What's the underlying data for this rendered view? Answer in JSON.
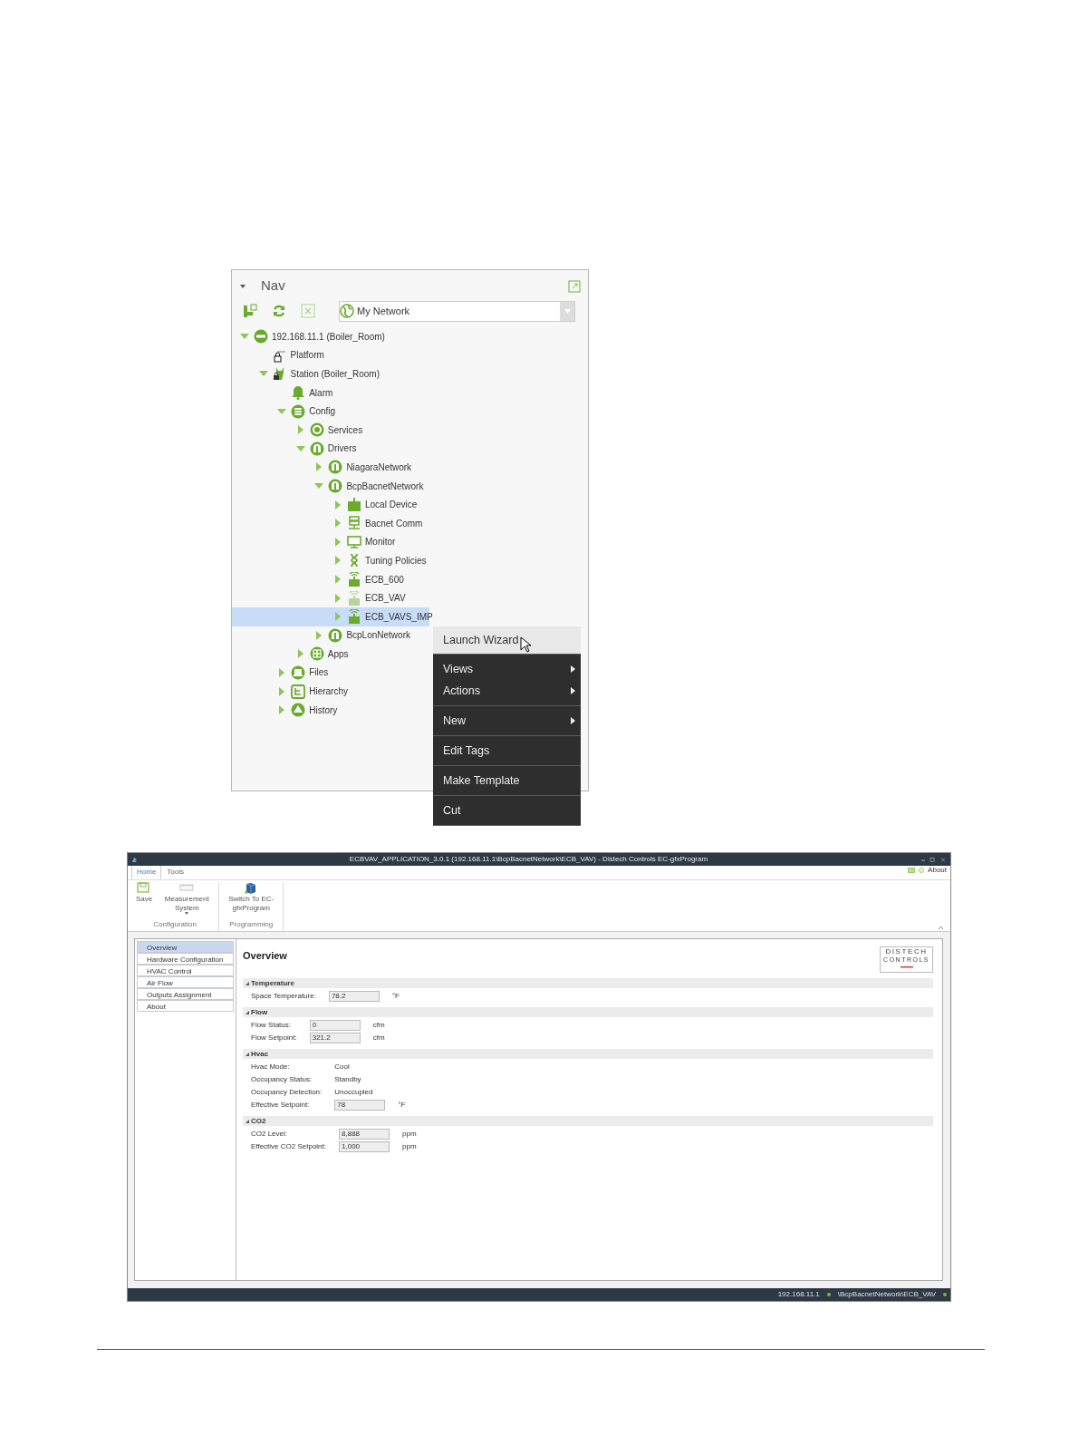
{
  "nav_panel": {
    "title": "Nav",
    "dropdown": {
      "value": "My Network"
    },
    "tree": [
      {
        "label": "192.168.11.1 (Boiler_Room)",
        "kind": "host",
        "expanded": true,
        "selected": false,
        "disabled": false,
        "children": [
          {
            "label": "Platform",
            "kind": "platform",
            "selected": false,
            "disabled": false
          },
          {
            "label": "Station (Boiler_Room)",
            "kind": "station",
            "expanded": true,
            "selected": false,
            "disabled": false,
            "children": [
              {
                "label": "Alarm",
                "kind": "alarm",
                "selected": false,
                "disabled": false
              },
              {
                "label": "Config",
                "kind": "config",
                "expanded": true,
                "selected": false,
                "disabled": false,
                "children": [
                  {
                    "label": "Services",
                    "kind": "services",
                    "expanded": false,
                    "selected": false,
                    "disabled": false
                  },
                  {
                    "label": "Drivers",
                    "kind": "network",
                    "expanded": true,
                    "selected": false,
                    "disabled": false,
                    "children": [
                      {
                        "label": "NiagaraNetwork",
                        "kind": "network",
                        "expanded": false,
                        "selected": false,
                        "disabled": false
                      },
                      {
                        "label": "BcpBacnetNetwork",
                        "kind": "network",
                        "expanded": true,
                        "selected": false,
                        "disabled": false,
                        "children": [
                          {
                            "label": "Local Device",
                            "kind": "device",
                            "expanded": false,
                            "selected": false,
                            "disabled": false
                          },
                          {
                            "label": "Bacnet Comm",
                            "kind": "comm",
                            "expanded": false,
                            "selected": false,
                            "disabled": false
                          },
                          {
                            "label": "Monitor",
                            "kind": "monitor",
                            "expanded": false,
                            "selected": false,
                            "disabled": false
                          },
                          {
                            "label": "Tuning Policies",
                            "kind": "policies",
                            "expanded": false,
                            "selected": false,
                            "disabled": false
                          },
                          {
                            "label": "ECB_600",
                            "kind": "controller",
                            "expanded": false,
                            "selected": false,
                            "disabled": false
                          },
                          {
                            "label": "ECB_VAV",
                            "kind": "controller",
                            "expanded": false,
                            "selected": false,
                            "disabled": true
                          },
                          {
                            "label": "ECB_VAVS_IMP",
                            "kind": "controller",
                            "expanded": false,
                            "selected": true,
                            "disabled": false
                          }
                        ]
                      },
                      {
                        "label": "BcpLonNetwork",
                        "kind": "network",
                        "expanded": false,
                        "selected": false,
                        "disabled": false
                      }
                    ]
                  },
                  {
                    "label": "Apps",
                    "kind": "apps",
                    "expanded": false,
                    "selected": false,
                    "disabled": false
                  }
                ]
              },
              {
                "label": "Files",
                "kind": "files",
                "expanded": false,
                "selected": false,
                "disabled": false
              },
              {
                "label": "Hierarchy",
                "kind": "hierarchy",
                "expanded": false,
                "selected": false,
                "disabled": false
              },
              {
                "label": "History",
                "kind": "history",
                "expanded": false,
                "selected": false,
                "disabled": false
              }
            ]
          }
        ]
      }
    ],
    "context_menu": {
      "groups": [
        {
          "items": [
            {
              "label": "Launch Wizard",
              "selected": true,
              "submenu": false
            }
          ]
        },
        {
          "items": [
            {
              "label": "Views",
              "selected": false,
              "submenu": true
            },
            {
              "label": "Actions",
              "selected": false,
              "submenu": true
            }
          ]
        },
        {
          "items": [
            {
              "label": "New",
              "selected": false,
              "submenu": true
            }
          ]
        },
        {
          "items": [
            {
              "label": "Edit Tags",
              "selected": false,
              "submenu": false
            }
          ]
        },
        {
          "items": [
            {
              "label": "Make Template",
              "selected": false,
              "submenu": false
            }
          ]
        },
        {
          "items": [
            {
              "label": "Cut",
              "selected": false,
              "submenu": false
            }
          ]
        }
      ]
    }
  },
  "app_window": {
    "title": "ECBVAV_APPLICATION_3.0.1 (192.168.11.1\\BcpBacnetNetwork\\ECB_VAV) - Distech Controls EC-gfxProgram",
    "ribbon_tabs": [
      {
        "label": "Home",
        "selected": true
      },
      {
        "label": "Tools",
        "selected": false
      }
    ],
    "about": "About",
    "ribbon_groups": [
      {
        "label": "Configuration",
        "buttons": [
          {
            "label": "Save",
            "kind": "save",
            "dropdown": false
          },
          {
            "label": "Measurement System",
            "kind": "measure",
            "dropdown": true
          }
        ]
      },
      {
        "label": "Programming",
        "buttons": [
          {
            "label": "Switch To EC-gfxProgram",
            "kind": "switch",
            "dropdown": false
          }
        ]
      }
    ],
    "side_nav": [
      {
        "label": "Overview",
        "selected": true
      },
      {
        "label": "Hardware Configuration",
        "selected": false
      },
      {
        "label": "HVAC Control",
        "selected": false
      },
      {
        "label": "Air Flow",
        "selected": false
      },
      {
        "label": "Outputs Assignment",
        "selected": false
      },
      {
        "label": "About",
        "selected": false
      }
    ],
    "heading": "Overview",
    "logo": {
      "line_1": "DISTECH",
      "line_2": "CONTROLS"
    },
    "sections": [
      {
        "title": "Temperature",
        "expanded": true,
        "rows": [
          {
            "label": "Space Temperature:",
            "kind": "field",
            "value": "78.2",
            "unit": "°F"
          }
        ]
      },
      {
        "title": "Flow",
        "expanded": true,
        "rows": [
          {
            "label": "Flow Status:",
            "kind": "field",
            "value": "0",
            "unit": "cfm"
          },
          {
            "label": "Flow Setpoint:",
            "kind": "field",
            "value": "321.2",
            "unit": "cfm"
          }
        ]
      },
      {
        "title": "Hvac",
        "expanded": true,
        "rows": [
          {
            "label": "Hvac Mode:",
            "kind": "text",
            "value": "Cool"
          },
          {
            "label": "Occupancy Status:",
            "kind": "text",
            "value": "Standby"
          },
          {
            "label": "Occupancy Detection:",
            "kind": "text",
            "value": "Unoccupied"
          },
          {
            "label": "Effective Setpoint:",
            "kind": "field",
            "value": "78",
            "unit": "°F"
          }
        ]
      },
      {
        "title": "CO2",
        "expanded": true,
        "rows": [
          {
            "label": "CO2 Level:",
            "kind": "field",
            "value": "8,888",
            "unit": "ppm"
          },
          {
            "label": "Effective CO2 Setpoint:",
            "kind": "field",
            "value": "1,000",
            "unit": "ppm"
          }
        ]
      }
    ],
    "status_bar": [
      "192.168.11.1",
      "\\BcpBacnetNetwork\\ECB_VAV"
    ]
  }
}
